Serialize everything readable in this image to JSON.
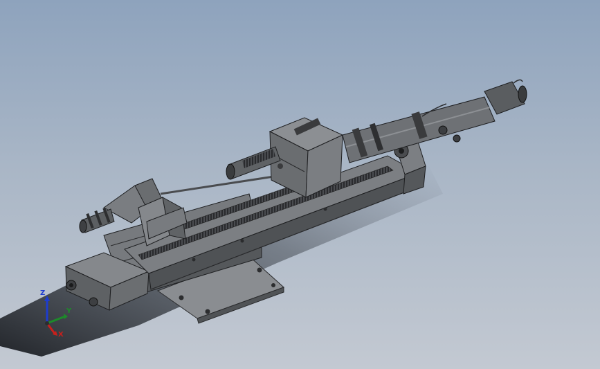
{
  "viewport": {
    "background_top": "#8ea3bd",
    "background_bottom": "#c3c9d2"
  },
  "model": {
    "part_color": "#6f7276",
    "edge_color": "#1e1f21"
  },
  "triad": {
    "x_label": "X",
    "y_label": "Y",
    "z_label": "Z",
    "x_color": "#c8201c",
    "y_color": "#1d8a2a",
    "z_color": "#1d3ccf"
  }
}
